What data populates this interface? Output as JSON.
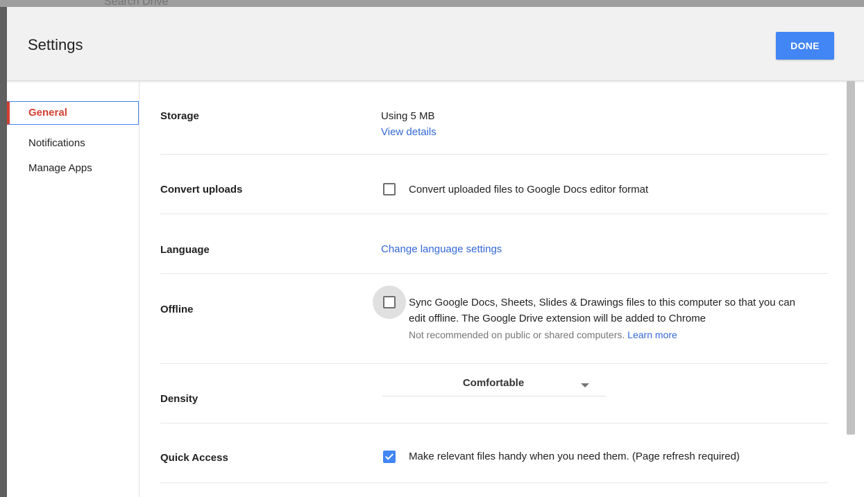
{
  "backdrop": {
    "search_placeholder": "Search Drive"
  },
  "dialog": {
    "title": "Settings",
    "done_label": "DONE"
  },
  "sidebar": {
    "items": [
      {
        "label": "General",
        "active": true
      },
      {
        "label": "Notifications",
        "active": false
      },
      {
        "label": "Manage Apps",
        "active": false
      }
    ]
  },
  "settings": {
    "storage": {
      "label": "Storage",
      "usage": "Using 5 MB",
      "link": "View details"
    },
    "convert_uploads": {
      "label": "Convert uploads",
      "text": "Convert uploaded files to Google Docs editor format",
      "checked": false
    },
    "language": {
      "label": "Language",
      "link": "Change language settings"
    },
    "offline": {
      "label": "Offline",
      "text_line1": "Sync Google Docs, Sheets, Slides & Drawings files to this computer so that you can",
      "text_line2": "edit offline. The Google Drive extension will be added to Chrome",
      "note": "Not recommended on public or shared computers.",
      "note_link": "Learn more",
      "checked": false
    },
    "density": {
      "label": "Density",
      "value": "Comfortable"
    },
    "quick_access": {
      "label": "Quick Access",
      "text": "Make relevant files handy when you need them. (Page refresh required)",
      "checked": true
    }
  },
  "colors": {
    "accent": "#4285f4",
    "active_nav": "#d23f31",
    "link": "#3367d6"
  }
}
